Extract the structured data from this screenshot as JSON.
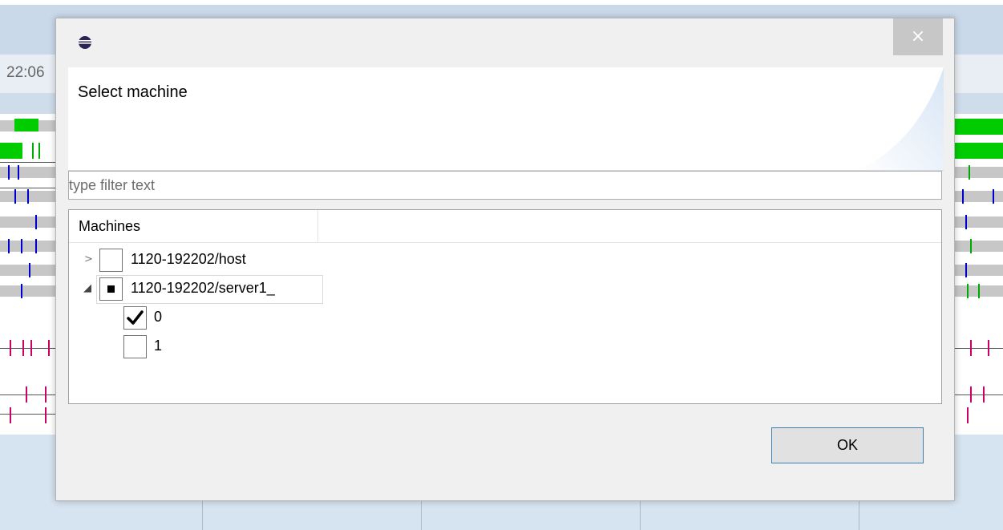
{
  "background": {
    "time_label": "22:06"
  },
  "dialog": {
    "title_icon": "eclipse-icon",
    "close_label": "×",
    "header_title": "Select machine",
    "filter": {
      "placeholder": "type filter text",
      "value": ""
    },
    "tree": {
      "column_header": "Machines",
      "nodes": [
        {
          "label": "1120-192202/host",
          "expanded": false,
          "check_state": "unchecked"
        },
        {
          "label": "1120-192202/server1_",
          "expanded": true,
          "check_state": "partial",
          "children": [
            {
              "label": "0",
              "check_state": "checked"
            },
            {
              "label": "1",
              "check_state": "unchecked"
            }
          ]
        }
      ]
    },
    "ok_label": "OK"
  },
  "colors": {
    "accent_border": "#3c7fb1",
    "close_bg": "#c7c7c7",
    "lane_green": "#00cc00",
    "lane_blue": "#0000cc",
    "lane_magenta": "#cc0066"
  }
}
